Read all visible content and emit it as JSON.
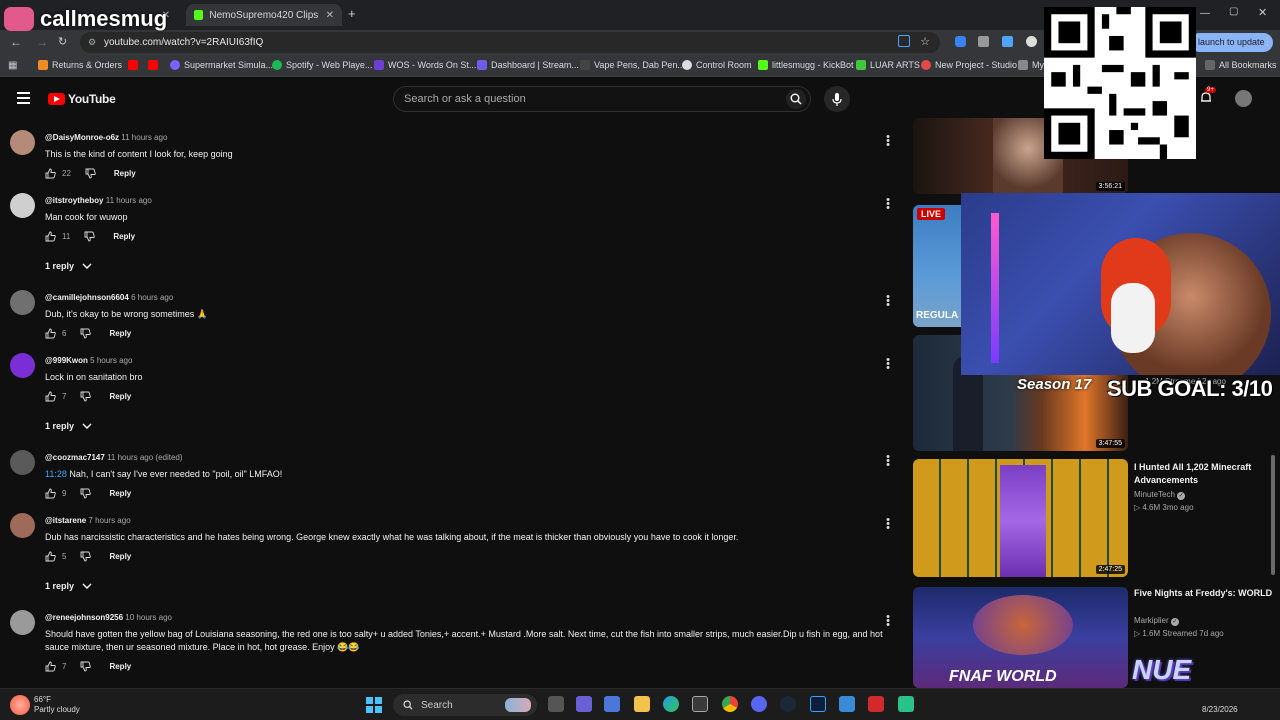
{
  "overlay": {
    "streamer_name": "callmesmug",
    "sub_goal": "SUB GOAL: 3/10",
    "season_label": "Season 17",
    "logo_text": "NUE"
  },
  "browser": {
    "tabs": [
      {
        "label": "NemoSupremo420 Clips - Watc",
        "active": false
      },
      {
        "label": "",
        "active": true
      }
    ],
    "url": "youtube.com/watch?v=2RAIUI63fIQ",
    "relaunch_label": "launch to update",
    "bookmarks": [
      {
        "label": "Returns & Orders",
        "color": "#f08a24"
      },
      {
        "label": "",
        "color": "#ff0000"
      },
      {
        "label": "",
        "color": "#ff0000"
      },
      {
        "label": "Supermarket Simula...",
        "color": "#7b61ff"
      },
      {
        "label": "Spotify - Web Playe...",
        "color": "#1db954"
      },
      {
        "label": "WOS - Words On St...",
        "color": "#6a3fd1"
      },
      {
        "label": "Dashboard | Stream...",
        "color": "#6c5ce7"
      },
      {
        "label": "Vape Pens, Dab Pen...",
        "color": "#444444"
      },
      {
        "label": "Control Room",
        "color": "#dddddd"
      },
      {
        "label": "littlesmugg - KickBot",
        "color": "#53fc18"
      },
      {
        "label": "LUAR ARTS",
        "color": "#3ec83e"
      },
      {
        "label": "New Project - Studio",
        "color": "#e24a4a"
      },
      {
        "label": "My",
        "color": "#888888"
      }
    ],
    "all_bookmarks": "All Bookmarks"
  },
  "youtube": {
    "logo": "YouTube",
    "search_placeholder": "Search or ask a question",
    "notif_count": "9+"
  },
  "comments": [
    {
      "user": "@DaisyMonroe-o6z",
      "time": "11 hours ago",
      "text": "This is the kind of content I look for, keep going",
      "likes": "22",
      "reply": "Reply",
      "replies": "",
      "avatar_color": "#b48a78"
    },
    {
      "user": "@itstroytheboy",
      "time": "11 hours ago",
      "text": "Man cook for wuwop",
      "likes": "11",
      "reply": "Reply",
      "replies": "1 reply",
      "avatar_color": "#cfcfcf"
    },
    {
      "user": "@camillejohnson6604",
      "time": "6 hours ago",
      "text": "Dub, it's okay to be wrong sometimes 🙏",
      "likes": "6",
      "reply": "Reply",
      "replies": "",
      "avatar_color": "#707070"
    },
    {
      "user": "@999Kwon",
      "time": "5 hours ago",
      "text": "Lock in on sanitation bro",
      "likes": "7",
      "reply": "Reply",
      "replies": "1 reply",
      "avatar_color": "#7a2fd6"
    },
    {
      "user": "@coozmac7147",
      "time": "11 hours ago (edited)",
      "timestamp": "11:28",
      "text": " Nah, I can't say I've ever needed to \"poil, oil\" LMFAO!",
      "likes": "9",
      "reply": "Reply",
      "replies": "",
      "avatar_color": "#5a5a5a"
    },
    {
      "user": "@itstarene",
      "time": "7 hours ago",
      "text": "Dub has narcissistic characteristics and he hates being wrong. George knew exactly what he was talking about, if the meat is thicker than obviously you have to cook it longer.",
      "likes": "5",
      "reply": "Reply",
      "replies": "1 reply",
      "avatar_color": "#a06a5a"
    },
    {
      "user": "@reneejohnson9256",
      "time": "10 hours ago",
      "text": "Should have gotten the yellow bag of Louisiana seasoning, the red one is too salty+ u added Tonies,+ accent.+ Mustard .More salt. Next time, cut the fish into smaller strips, much easier.Dip u fish in egg, and hot sauce mixture, then ur seasoned mixture. Place in hot, hot grease. Enjoy 😂😂",
      "likes": "7",
      "reply": "Reply",
      "replies": "",
      "avatar_color": "#9a9a9a"
    }
  ],
  "sidebar_videos": [
    {
      "title": "",
      "channel": "",
      "stats": "",
      "duration": "3:56:21",
      "live": false
    },
    {
      "title": "",
      "channel": "",
      "stats": "",
      "duration": "",
      "live": true,
      "live_label": "LIVE",
      "thumb_text": "REGULA"
    },
    {
      "title": "",
      "channel": "",
      "stats": "• 1.2M Streamed 2y ago",
      "duration": "3:47:55",
      "live": false
    },
    {
      "title": "I Hunted All 1,202 Minecraft Advancements",
      "channel": "MinuteTech",
      "stats": "▷ 4.6M  3mo ago",
      "duration": "2:47:25",
      "live": false
    },
    {
      "title": "Five Nights at Freddy's: WORLD",
      "channel": "Markiplier",
      "stats": "▷ 1.6M  Streamed 7d ago",
      "duration": "",
      "live": false,
      "thumb_text": "FNAF WORLD"
    }
  ],
  "taskbar": {
    "weather_temp": "66°F",
    "weather_desc": "Partly cloudy",
    "search_label": "Search",
    "time": "",
    "date": "8/23/2026"
  }
}
